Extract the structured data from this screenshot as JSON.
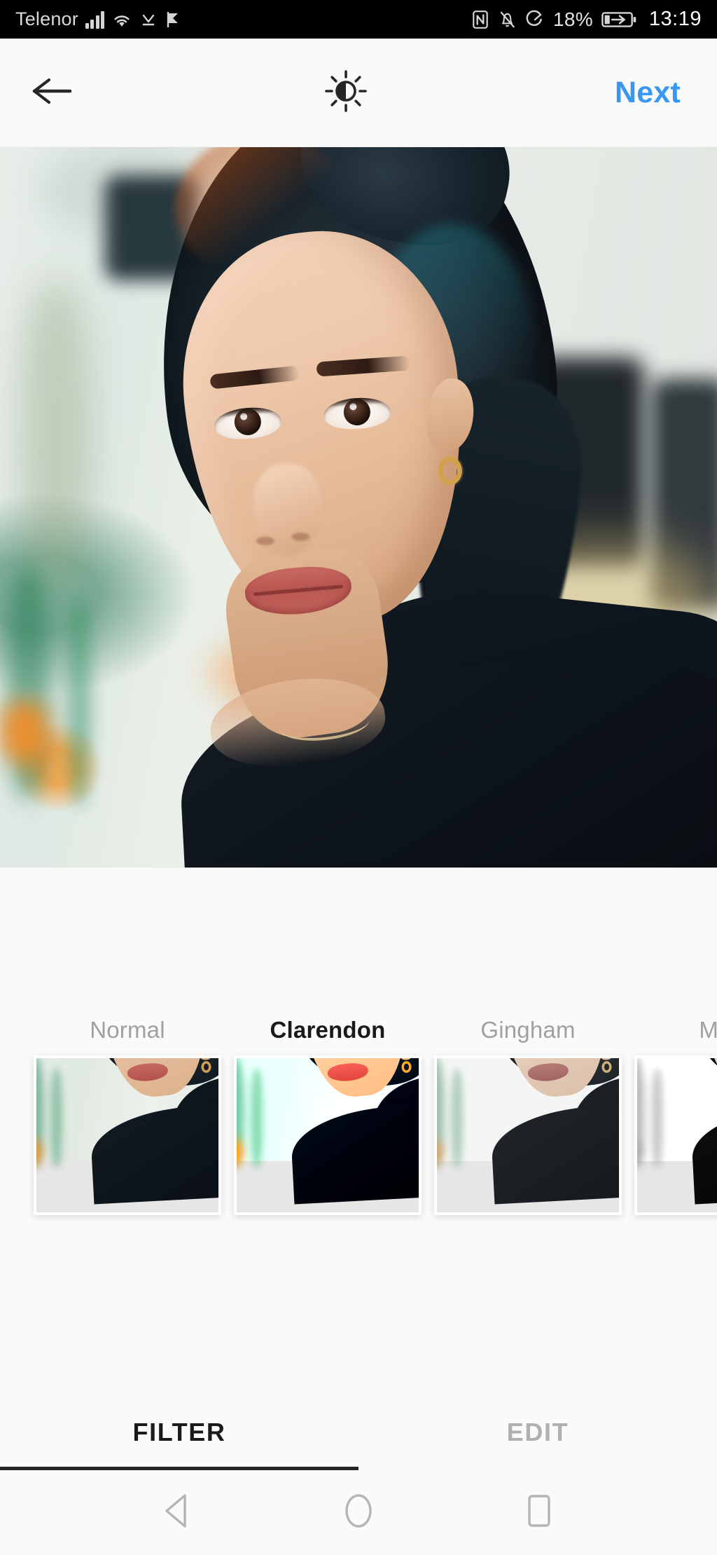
{
  "status_bar": {
    "carrier": "Telenor",
    "battery_percent": "18%",
    "time": "13:19",
    "icons": [
      "signal-bars-icon",
      "wifi-icon",
      "download-icon",
      "play-flag-icon",
      "nfc-icon",
      "bell-muted-icon",
      "data-saver-icon",
      "battery-charging-icon"
    ]
  },
  "topbar": {
    "back_label": "back-arrow",
    "lux_label": "brightness-lux",
    "next_label": "Next"
  },
  "photo": {
    "alt": "portrait of a woman with dark hair in a bun wearing a black top"
  },
  "filters": {
    "items": [
      {
        "name": "Normal",
        "selected": false,
        "grade": "f-normal"
      },
      {
        "name": "Clarendon",
        "selected": true,
        "grade": "f-clarendon"
      },
      {
        "name": "Gingham",
        "selected": false,
        "grade": "f-gingham"
      },
      {
        "name": "Moon",
        "selected": false,
        "grade": "f-moon"
      }
    ]
  },
  "tabs": {
    "items": [
      {
        "label": "FILTER",
        "active": true
      },
      {
        "label": "EDIT",
        "active": false
      }
    ]
  },
  "android_nav": {
    "back": "back-triangle",
    "home": "home-circle",
    "recents": "recents-square"
  },
  "colors": {
    "accent_blue": "#3897f0",
    "bg": "#fafafa",
    "text_primary": "#1a1a1a",
    "text_muted": "#a0a0a0",
    "statusbar_bg": "#000000"
  }
}
